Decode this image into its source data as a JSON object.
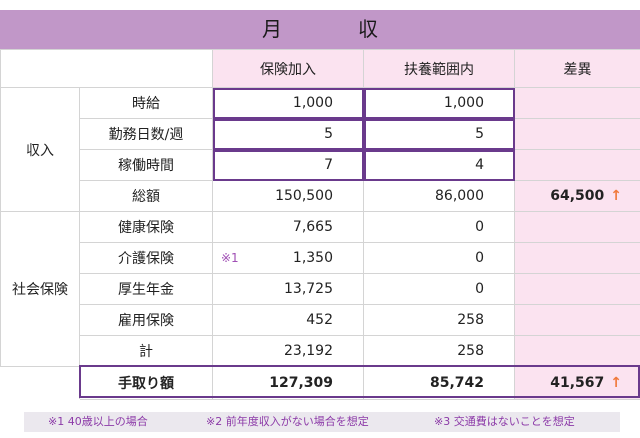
{
  "title": "月　収",
  "headers": {
    "col1": "保険加入",
    "col2": "扶養範囲内",
    "col3": "差異"
  },
  "income": {
    "group_label": "収入",
    "rows": [
      {
        "label": "時給",
        "a": "1,000",
        "b": "1,000",
        "diff": ""
      },
      {
        "label": "勤務日数/週",
        "a": "5",
        "b": "5",
        "diff": ""
      },
      {
        "label": "稼働時間",
        "a": "7",
        "b": "4",
        "diff": ""
      },
      {
        "label": "総額",
        "a": "150,500",
        "b": "86,000",
        "diff": "64,500"
      }
    ]
  },
  "insurance": {
    "group_label": "社会保険",
    "rows": [
      {
        "label": "健康保険",
        "a": "7,665",
        "b": "0",
        "note": ""
      },
      {
        "label": "介護保険",
        "a": "1,350",
        "b": "0",
        "note": "※1"
      },
      {
        "label": "厚生年金",
        "a": "13,725",
        "b": "0",
        "note": ""
      },
      {
        "label": "雇用保険",
        "a": "452",
        "b": "258",
        "note": ""
      },
      {
        "label": "計",
        "a": "23,192",
        "b": "258",
        "note": ""
      }
    ]
  },
  "total": {
    "label": "手取り額",
    "a": "127,309",
    "b": "85,742",
    "diff": "41,567"
  },
  "arrow_glyph": "↑",
  "footnotes": [
    "※1 40歳以上の場合",
    "※2 前年度収入がない場合を想定",
    "※3 交通費はないことを想定"
  ],
  "colors": {
    "title_bg": "#c197c8",
    "pink": "#fbe3f0",
    "frame": "#6a3a8c",
    "arrow": "#f07a3c",
    "footnote_text": "#8c3aa8"
  }
}
